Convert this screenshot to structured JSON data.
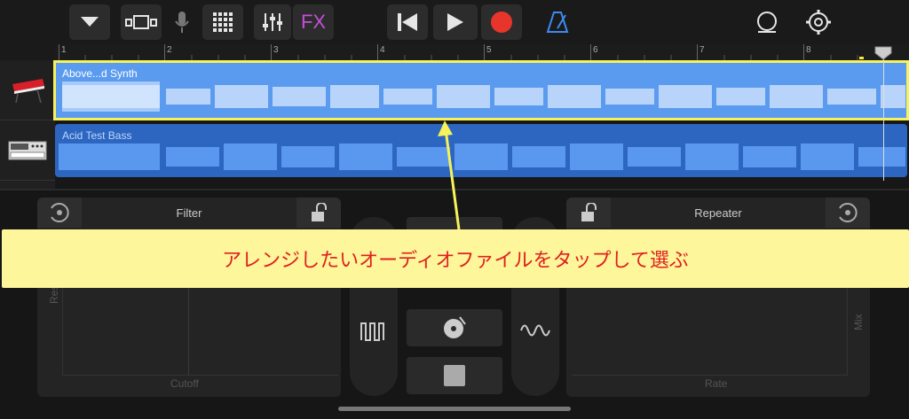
{
  "toolbar": {
    "fx_label": "FX",
    "buttons": [
      "dropdown-icon",
      "view-icon",
      "mic-icon",
      "grid-icon",
      "mixer-icon",
      "fx",
      "rewind-icon",
      "play-icon",
      "record-icon",
      "metronome-icon",
      "loop-icon",
      "settings-icon"
    ]
  },
  "ruler": {
    "bars": [
      "1",
      "2",
      "3",
      "4",
      "5",
      "6",
      "7",
      "8"
    ]
  },
  "tracks": [
    {
      "name": "Above...d Synth",
      "icon": "synth-keyboard-icon",
      "selected": true,
      "color": "#5b9bef"
    },
    {
      "name": "Acid Test Bass",
      "icon": "bass-synth-icon",
      "selected": false,
      "color": "#2d66c0"
    }
  ],
  "plugins": {
    "left": {
      "title": "Filter",
      "x_axis": "Cutoff",
      "y_axis": "Resonance"
    },
    "right": {
      "title": "Repeater",
      "x_axis": "Rate",
      "y_axis": "Mix"
    }
  },
  "annotation": {
    "text": "アレンジしたいオーディオファイルをタップして選ぶ",
    "highlight_color": "#f7f25a",
    "text_color": "#e02020"
  }
}
